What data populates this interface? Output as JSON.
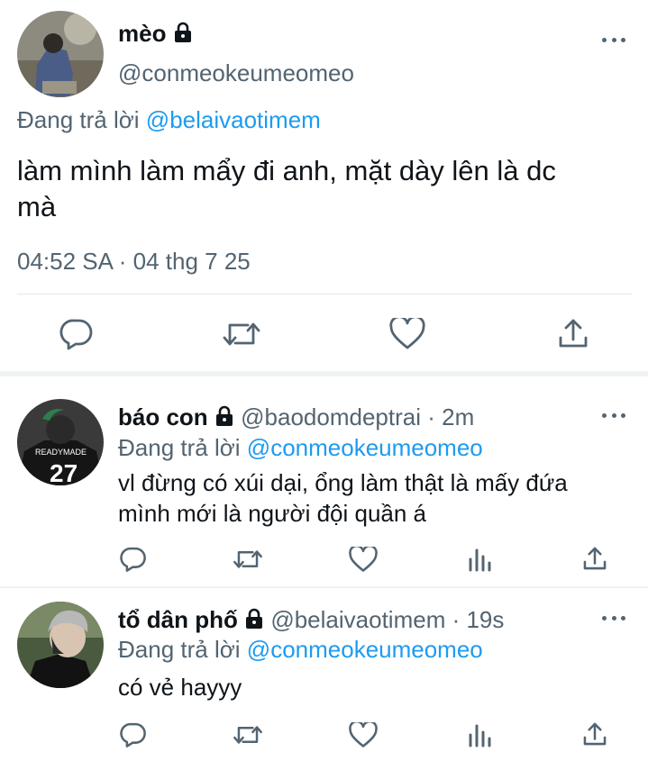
{
  "main_tweet": {
    "display_name": "mèo",
    "handle": "@conmeokeumeomeo",
    "reply_prefix": "Đang trả lời",
    "reply_to": "@belaivaotimem",
    "text_line1": "làm mình làm mẩy đi anh, mặt dày lên là dc",
    "text_line2": "mà",
    "timestamp": "04:52 SA · 04 thg 7 25"
  },
  "replies": [
    {
      "display_name": "báo con",
      "handle": "@baodomdeptrai",
      "time": "· 2m",
      "reply_prefix": "Đang trả lời",
      "reply_to": "@conmeokeumeomeo",
      "text_line1": "vl đừng có xúi dại, ổng làm thật là mấy đứa",
      "text_line2": "mình mới là người đội quần á"
    },
    {
      "display_name": "tổ dân phố",
      "handle": "@belaivaotimem",
      "time": "· 19s",
      "reply_prefix": "Đang trả lời",
      "reply_to": "@conmeokeumeomeo",
      "text_line1": "có vẻ hayyy"
    }
  ],
  "colors": {
    "link": "#1d9bf0",
    "muted": "#536471",
    "text": "#0f1419",
    "divider": "#eff3f4"
  }
}
